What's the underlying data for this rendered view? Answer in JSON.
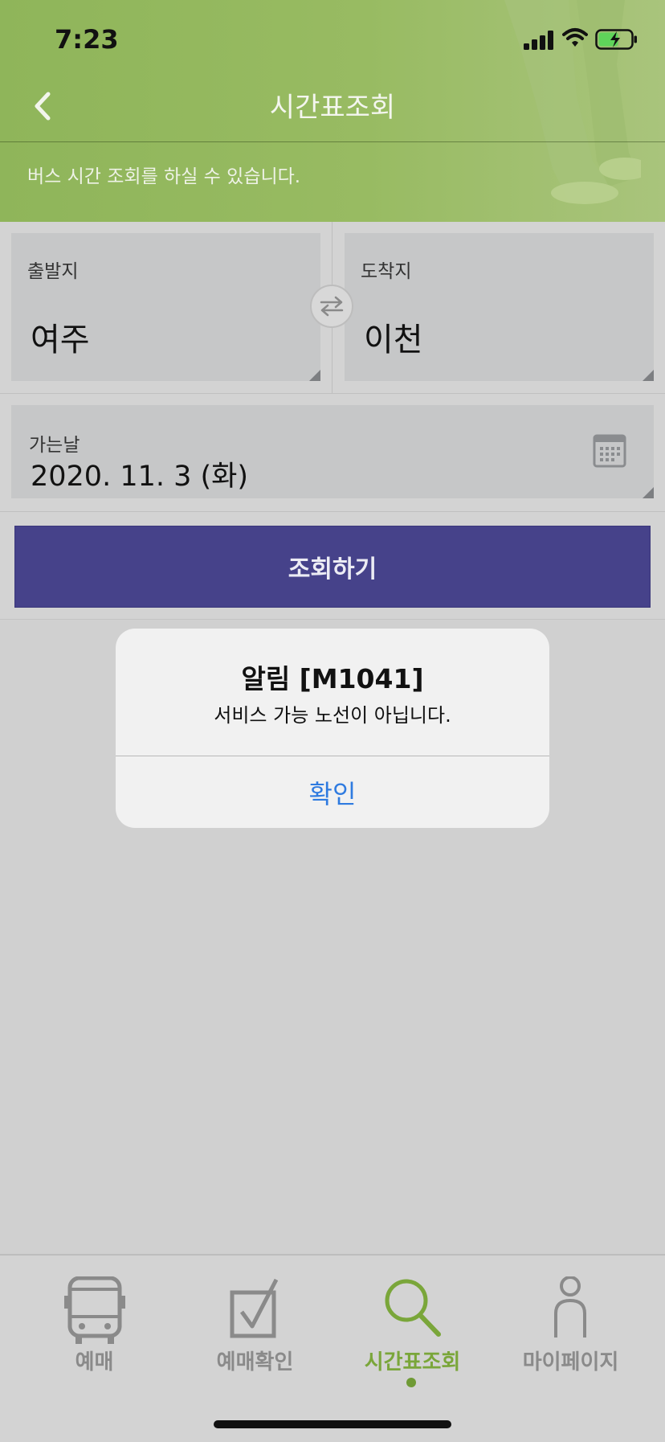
{
  "status_bar": {
    "time": "7:23"
  },
  "header": {
    "title": "시간표조회",
    "subtitle": "버스 시간 조회를 하실 수 있습니다."
  },
  "search": {
    "departure": {
      "label": "출발지",
      "value": "여주"
    },
    "arrival": {
      "label": "도착지",
      "value": "이천"
    },
    "date": {
      "label": "가는날",
      "value": "2020. 11. 3 (화)"
    },
    "button_label": "조회하기"
  },
  "alert": {
    "title": "알림 [M1041]",
    "message": "서비스 가능 노선이 아닙니다.",
    "confirm_label": "확인"
  },
  "tabbar": {
    "items": [
      {
        "label": "예매",
        "icon": "bus-icon"
      },
      {
        "label": "예매확인",
        "icon": "checkbox-icon"
      },
      {
        "label": "시간표조회",
        "icon": "search-icon",
        "active": true
      },
      {
        "label": "마이페이지",
        "icon": "person-icon"
      }
    ]
  },
  "colors": {
    "header_green": "#98bb62",
    "primary_button": "#46428a",
    "active_tab": "#7aa63a",
    "alert_action": "#2f7be0"
  }
}
